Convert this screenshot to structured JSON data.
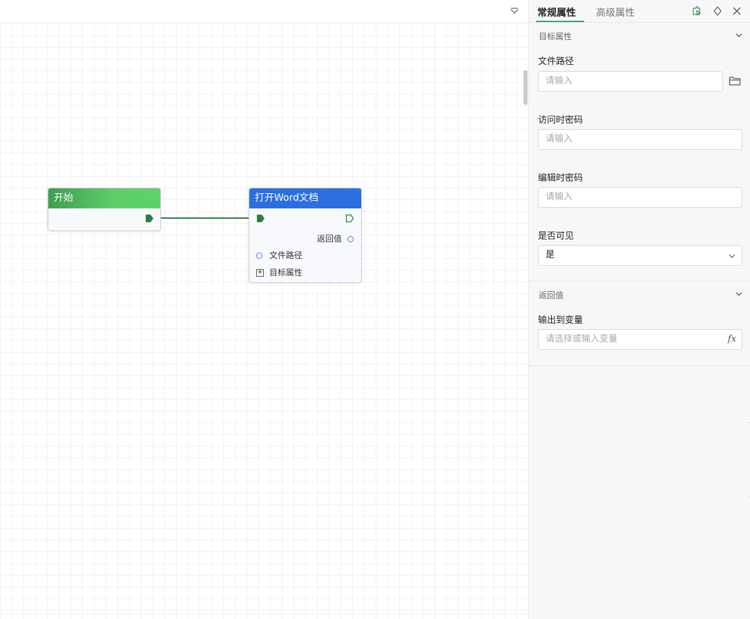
{
  "canvas": {
    "collapse_icon": "chevron-down-icon"
  },
  "nodes": {
    "start": {
      "title": "开始",
      "color": "#4caf5a"
    },
    "open_word": {
      "title": "打开Word文档",
      "color": "#2b6fe0",
      "return_label": "返回值",
      "input_label": "文件路径",
      "group_label": "目标属性"
    }
  },
  "panel": {
    "tabs": [
      {
        "label": "常规属性",
        "active": true
      },
      {
        "label": "高级属性",
        "active": false
      }
    ],
    "icons": [
      "run-icon",
      "diamond-icon",
      "close-icon"
    ],
    "sections": {
      "target": {
        "title": "目标属性",
        "fields": {
          "file_path": {
            "label": "文件路径",
            "placeholder": "请输入"
          },
          "open_password": {
            "label": "访问时密码",
            "placeholder": "请输入"
          },
          "edit_password": {
            "label": "编辑时密码",
            "placeholder": "请输入"
          },
          "visible": {
            "label": "是否可见",
            "value": "是"
          }
        }
      },
      "return": {
        "title": "返回值",
        "fields": {
          "output_var": {
            "label": "输出到变量",
            "placeholder": "请选择或输入变量",
            "fx_label": "fx"
          }
        }
      }
    }
  },
  "colors": {
    "accent": "#2fae5c",
    "edge": "#2e7d3f"
  }
}
